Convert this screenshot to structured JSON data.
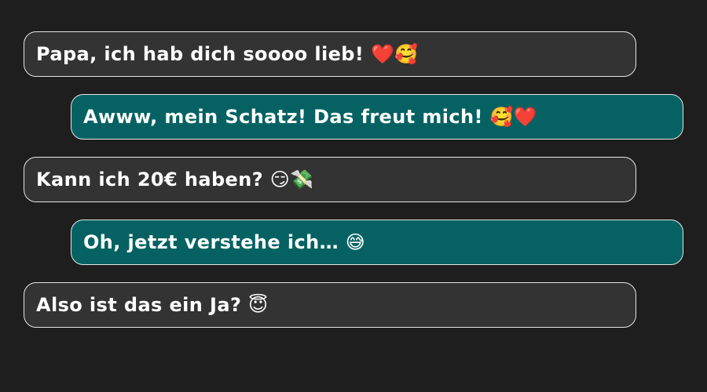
{
  "colors": {
    "background": "#1e1e1e",
    "incoming_bubble": "#333333",
    "outgoing_bubble": "#066262",
    "text": "#ffffff",
    "border": "#e6e6e6"
  },
  "messages": [
    {
      "side": "left",
      "text": "Papa, ich hab dich soooo lieb! ❤️🥰"
    },
    {
      "side": "right",
      "text": "Awww, mein Schatz! Das freut mich! 🥰❤️"
    },
    {
      "side": "left",
      "text": "Kann ich 20€ haben? 😏💸"
    },
    {
      "side": "right",
      "text": "Oh, jetzt verstehe ich… 😅"
    },
    {
      "side": "left",
      "text": "Also ist das ein Ja? 😇"
    }
  ]
}
